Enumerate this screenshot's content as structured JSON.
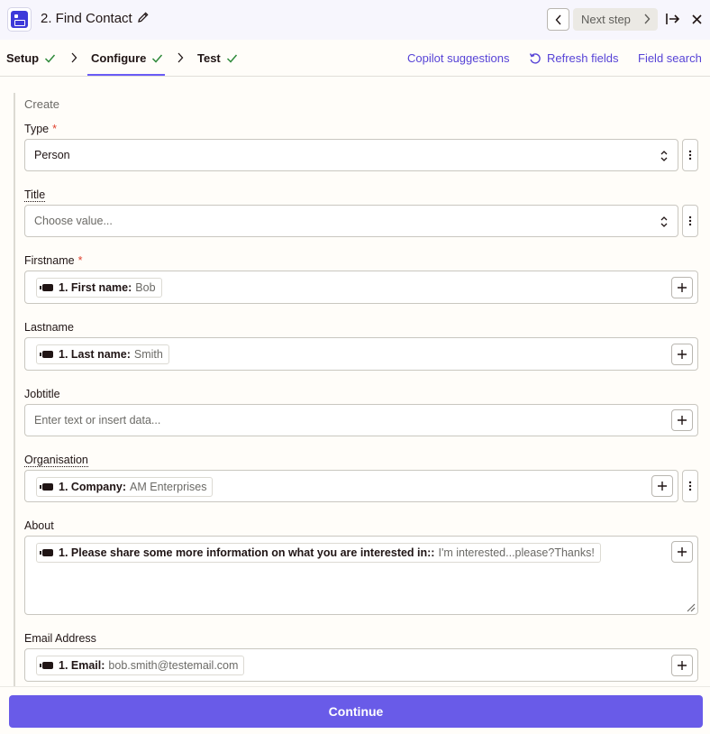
{
  "header": {
    "step_title": "2. Find Contact",
    "next_step_label": "Next step"
  },
  "tabs": [
    {
      "label": "Setup"
    },
    {
      "label": "Configure"
    },
    {
      "label": "Test"
    }
  ],
  "actions": {
    "copilot": "Copilot suggestions",
    "refresh": "Refresh fields",
    "field_search": "Field search"
  },
  "form": {
    "section": "Create",
    "type": {
      "label": "Type",
      "value": "Person"
    },
    "title": {
      "label": "Title",
      "placeholder": "Choose value..."
    },
    "firstname": {
      "label": "Firstname",
      "pill_key": "1. First name:",
      "pill_value": "Bob"
    },
    "lastname": {
      "label": "Lastname",
      "pill_key": "1. Last name:",
      "pill_value": "Smith"
    },
    "jobtitle": {
      "label": "Jobtitle",
      "placeholder": "Enter text or insert data..."
    },
    "organisation": {
      "label": "Organisation",
      "pill_key": "1. Company:",
      "pill_value": "AM Enterprises"
    },
    "about": {
      "label": "About",
      "pill_key": "1. Please share some more information on what you are interested in::",
      "pill_value": "I'm interested...please?Thanks!"
    },
    "email": {
      "label": "Email Address",
      "pill_key": "1. Email:",
      "pill_value": "bob.smith@testemail.com"
    }
  },
  "footer": {
    "continue_label": "Continue"
  },
  "colors": {
    "accent": "#695be8",
    "link": "#5743d6",
    "success": "#2f8a3b",
    "required": "#e0412e"
  }
}
